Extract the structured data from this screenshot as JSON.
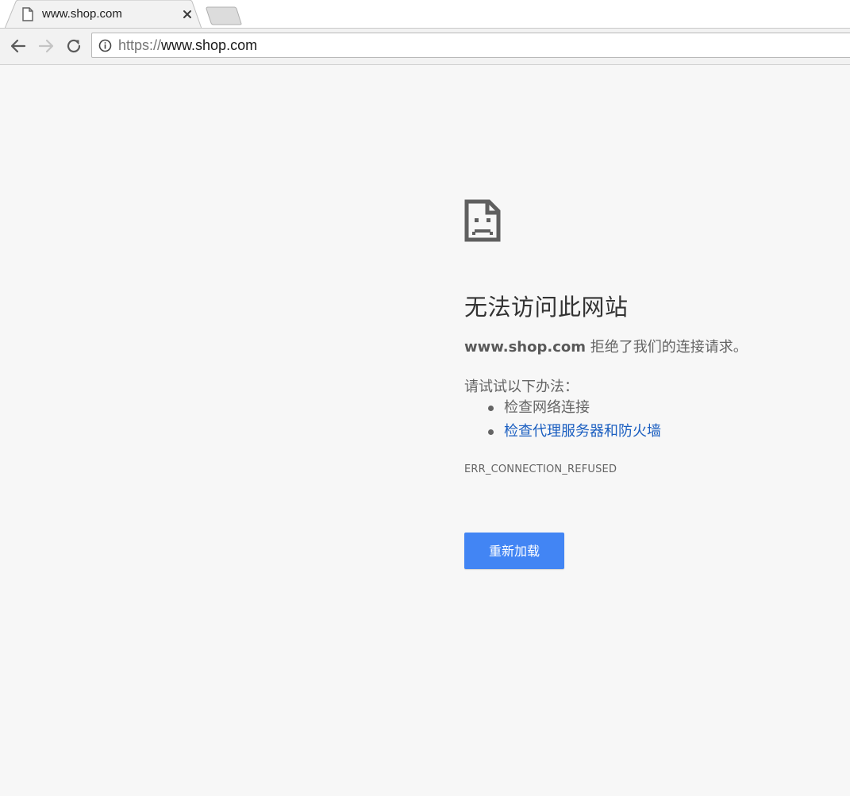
{
  "browser": {
    "tab": {
      "title": "www.shop.com",
      "favicon": "page-icon",
      "close_icon": "close-icon"
    },
    "new_tab_icon": "new-tab-icon",
    "nav": {
      "back_icon": "arrow-left-icon",
      "forward_icon": "arrow-right-icon",
      "reload_icon": "reload-icon"
    },
    "omnibox": {
      "info_icon": "info-icon",
      "url_scheme": "https://",
      "url_host": "www.shop.com"
    }
  },
  "error_page": {
    "icon": "sad-page-icon",
    "title": "无法访问此网站",
    "description_host": "www.shop.com",
    "description_text": " 拒绝了我们的连接请求。",
    "suggestions_heading": "请试试以下办法：",
    "suggestions": [
      {
        "label": "检查网络连接",
        "is_link": false
      },
      {
        "label": "检查代理服务器和防火墙",
        "is_link": true
      }
    ],
    "error_code": "ERR_CONNECTION_REFUSED",
    "reload_button_label": "重新加载"
  },
  "colors": {
    "page_background": "#f7f7f7",
    "button_blue": "#4285f4",
    "link_blue": "#1a5ec0",
    "text_gray": "#646464",
    "title_dark": "#333333"
  }
}
